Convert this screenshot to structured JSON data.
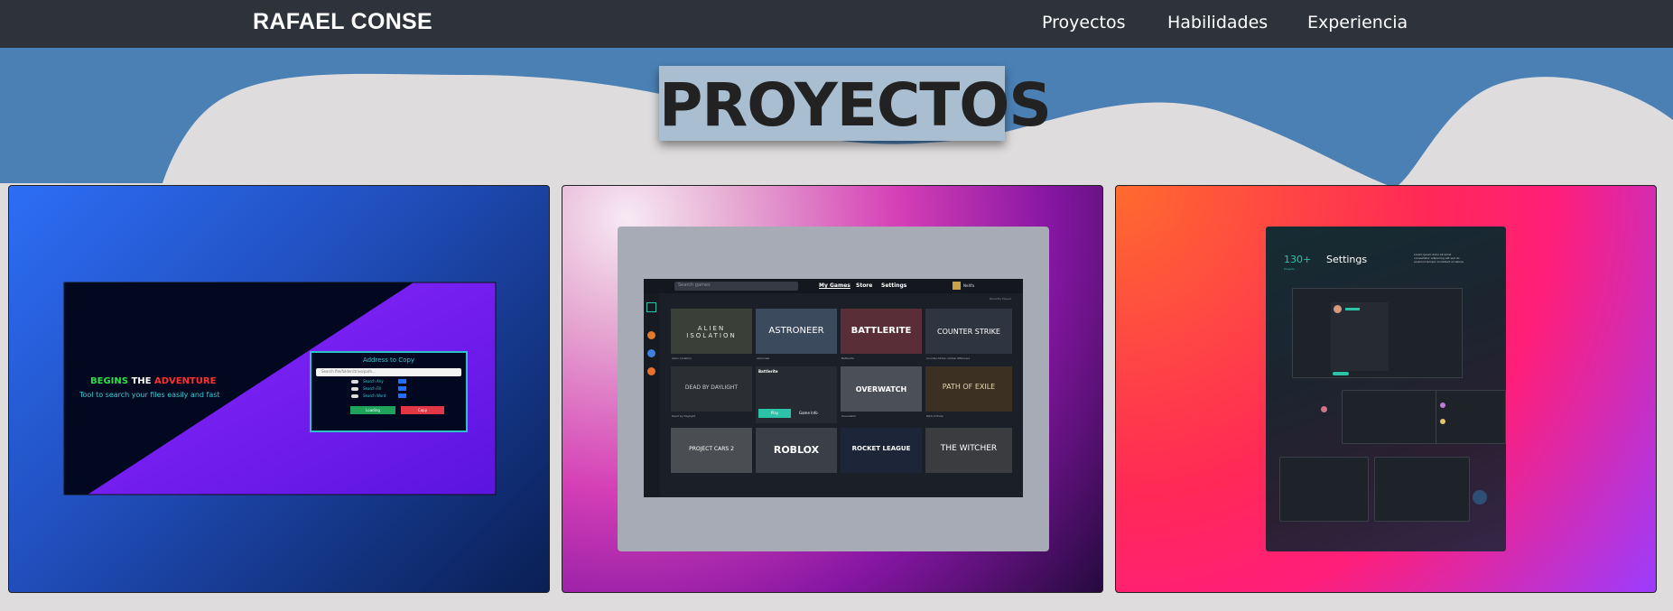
{
  "nav": {
    "brand": "RAFAEL CONSE",
    "links": [
      "Proyectos",
      "Habilidades",
      "Experiencia"
    ]
  },
  "hero": {
    "title": "PROYECTOS"
  },
  "projects": [
    {
      "tagline_begins": "BEGINS",
      "tagline_the": "THE",
      "tagline_adventure": "ADVENTURE",
      "subtitle": "Tool to search your files easily and fast",
      "panel": {
        "title": "Address to Copy",
        "placeholder": "Search file/folder/drive/path...",
        "options": [
          "Search Any",
          "Search Fill",
          "Search Word"
        ],
        "buttons": [
          "Loading",
          "Copy"
        ]
      }
    },
    {
      "search_placeholder": "Search games",
      "tabs": [
        "My Games",
        "Store",
        "Settings"
      ],
      "user": "NeXfa",
      "sort_label": "Recently Played",
      "games": [
        {
          "title": "ALIEN ISOLATION",
          "caption": "Alien: Isolation"
        },
        {
          "title": "ASTRONEER",
          "caption": "Astroneer"
        },
        {
          "title": "BATTLERITE",
          "caption": "Battlerite"
        },
        {
          "title": "COUNTER STRIKE",
          "caption": "Counter-Strike: Global Offensive"
        },
        {
          "title": "DEAD BY DAYLIGHT",
          "caption": "Dead by Daylight"
        },
        {
          "title": "Battlerite",
          "caption": ""
        },
        {
          "title": "OVERWATCH",
          "caption": "Overwatch"
        },
        {
          "title": "PATH OF EXILE",
          "caption": "Path of Exile"
        },
        {
          "title": "PROJECT CARS 2",
          "caption": ""
        },
        {
          "title": "ROBLOX",
          "caption": ""
        },
        {
          "title": "ROCKET LEAGUE",
          "caption": ""
        },
        {
          "title": "THE WITCHER",
          "caption": ""
        }
      ],
      "play_label": "Play",
      "more_label": "Game Info"
    },
    {
      "stat": "130+",
      "stat_caption": "Projects",
      "heading": "Settings",
      "desc": "Lorem ipsum dolor sit amet consectetur adipiscing elit sed do eiusmod tempor incididunt ut labore"
    }
  ],
  "colors": {
    "nav_bg": "#2e333b",
    "wave_blue": "#4b80b5",
    "page_bg": "#dedcdd",
    "title_box": "#a9bed0",
    "accent_teal": "#2bc2a7"
  }
}
